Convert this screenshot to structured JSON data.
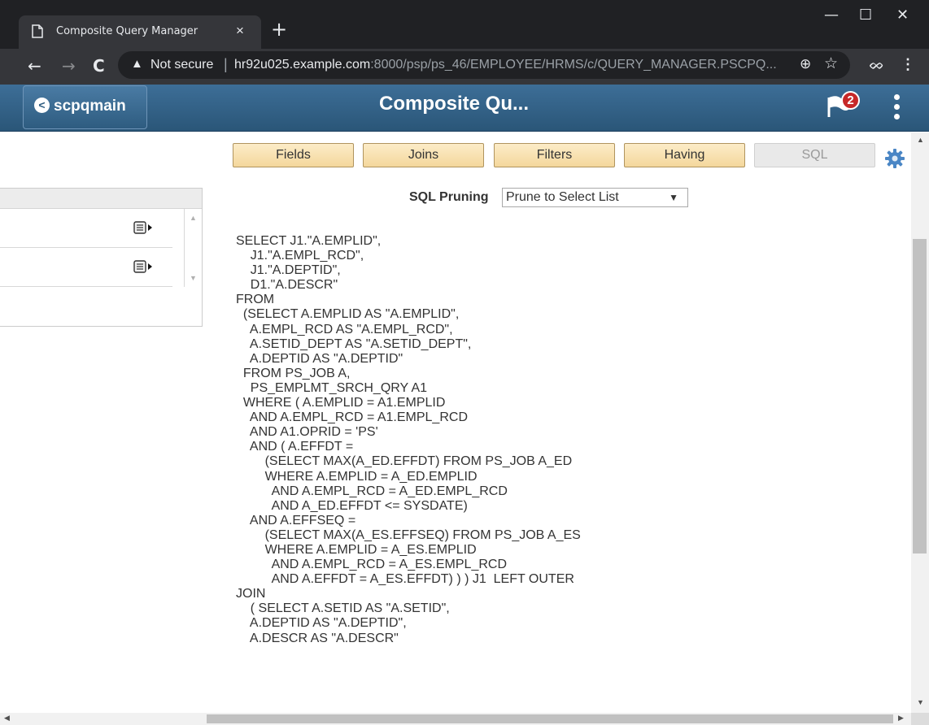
{
  "browser": {
    "tab_title": "Composite Query Manager",
    "tab_close": "×",
    "new_tab": "+",
    "minimize": "—",
    "maximize": "☐",
    "close": "✕",
    "back": "←",
    "forward": "→",
    "reload": "C",
    "not_secure_icon": "▲",
    "not_secure_label": "Not secure",
    "separator": "|",
    "url_host": "hr92u025.example.com",
    "url_path": ":8000/psp/ps_46/EMPLOYEE/HRMS/c/QUERY_MANAGER.PSCPQ...",
    "zoom_icon": "⊕",
    "star_icon": "☆",
    "extension_icon": "ᨖ",
    "menu_icon": "⋮"
  },
  "header": {
    "back_label": "scpqmain",
    "back_chevron": "<",
    "title": "Composite Qu...",
    "notification_count": "2"
  },
  "tabs": [
    {
      "label": "Fields",
      "enabled": true
    },
    {
      "label": "Joins",
      "enabled": true
    },
    {
      "label": "Filters",
      "enabled": true
    },
    {
      "label": "Having",
      "enabled": true
    },
    {
      "label": "SQL",
      "enabled": false
    }
  ],
  "sql_pruning": {
    "label": "SQL Pruning",
    "selected": "Prune to Select List",
    "arrow": "▼"
  },
  "grid": {
    "scroll_up": "▲",
    "scroll_down": "▼"
  },
  "sql_text": "SELECT J1.\"A.EMPLID\",\n    J1.\"A.EMPL_RCD\",\n    J1.\"A.DEPTID\",\n    D1.\"A.DESCR\"\nFROM\n  (SELECT A.EMPLID AS \"A.EMPLID\",\n    A.EMPL_RCD AS \"A.EMPL_RCD\",\n    A.SETID_DEPT AS \"A.SETID_DEPT\",\n    A.DEPTID AS \"A.DEPTID\"\n  FROM PS_JOB A,\n    PS_EMPLMT_SRCH_QRY A1\n  WHERE ( A.EMPLID = A1.EMPLID\n    AND A.EMPL_RCD = A1.EMPL_RCD\n    AND A1.OPRID = 'PS'\n    AND ( A.EFFDT =\n        (SELECT MAX(A_ED.EFFDT) FROM PS_JOB A_ED\n        WHERE A.EMPLID = A_ED.EMPLID\n          AND A.EMPL_RCD = A_ED.EMPL_RCD\n          AND A_ED.EFFDT <= SYSDATE)\n    AND A.EFFSEQ =\n        (SELECT MAX(A_ES.EFFSEQ) FROM PS_JOB A_ES\n        WHERE A.EMPLID = A_ES.EMPLID\n          AND A.EMPL_RCD = A_ES.EMPL_RCD\n          AND A.EFFDT = A_ES.EFFDT) ) ) J1  LEFT OUTER\nJOIN\n    ( SELECT A.SETID AS \"A.SETID\",\n    A.DEPTID AS \"A.DEPTID\",\n    A.DESCR AS \"A.DESCR\"",
  "scrollbars": {
    "up": "▲",
    "down": "▼",
    "left": "◀",
    "right": "▶"
  }
}
